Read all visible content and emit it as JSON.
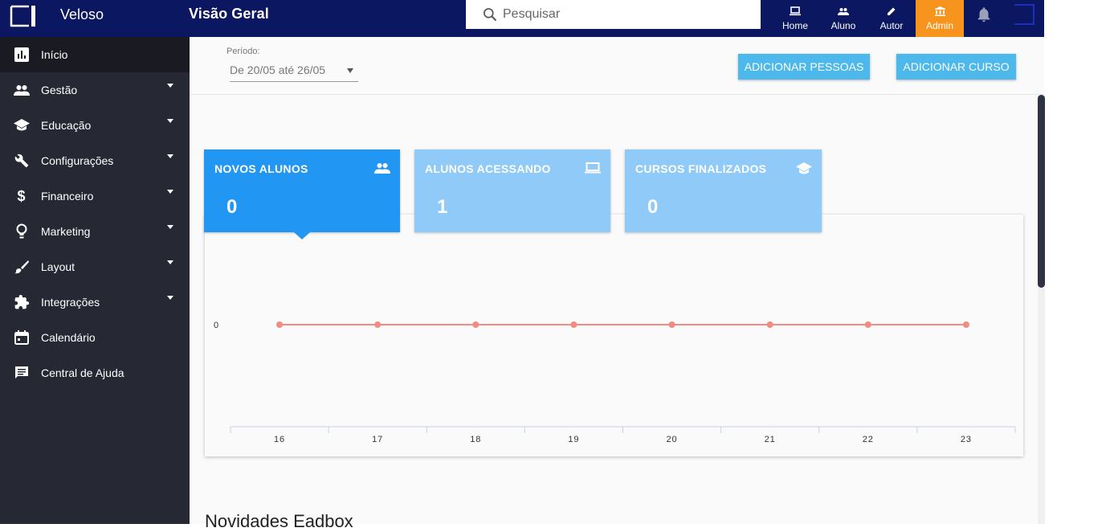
{
  "brand": "Veloso",
  "page_title": "Visão Geral",
  "search": {
    "placeholder": "Pesquisar"
  },
  "nav": {
    "home": "Home",
    "aluno": "Aluno",
    "autor": "Autor",
    "admin": "Admin"
  },
  "colors": {
    "topbar": "#0b1760",
    "sidebar": "#262833",
    "accent": "#f7941d",
    "primary": "#2196f3",
    "primary_light": "#90caf9",
    "button": "#4cb8ec",
    "line": "#f28b82"
  },
  "sidebar": {
    "items": [
      {
        "label": "Início",
        "icon": "bar-chart-icon",
        "expandable": false,
        "active": true
      },
      {
        "label": "Gestão",
        "icon": "people-icon",
        "expandable": true
      },
      {
        "label": "Educação",
        "icon": "graduation-cap-icon",
        "expandable": true
      },
      {
        "label": "Configurações",
        "icon": "wrench-icon",
        "expandable": true
      },
      {
        "label": "Financeiro",
        "icon": "dollar-icon",
        "expandable": true
      },
      {
        "label": "Marketing",
        "icon": "lightbulb-icon",
        "expandable": true
      },
      {
        "label": "Layout",
        "icon": "brush-icon",
        "expandable": true
      },
      {
        "label": "Integrações",
        "icon": "puzzle-icon",
        "expandable": true
      },
      {
        "label": "Calendário",
        "icon": "calendar-icon",
        "expandable": false
      },
      {
        "label": "Central de Ajuda",
        "icon": "chat-icon",
        "expandable": false
      }
    ]
  },
  "filter": {
    "period_label": "Período:",
    "period_value": "De 20/05 até 26/05",
    "add_people": "ADICIONAR PESSOAS",
    "add_course": "ADICIONAR CURSO"
  },
  "cards": [
    {
      "title": "NOVOS ALUNOS",
      "value": "0",
      "icon": "people-icon",
      "selected": true
    },
    {
      "title": "ALUNOS ACESSANDO",
      "value": "1",
      "icon": "laptop-icon",
      "selected": false
    },
    {
      "title": "CURSOS FINALIZADOS",
      "value": "0",
      "icon": "graduation-cap-icon",
      "selected": false
    }
  ],
  "chart_data": {
    "type": "line",
    "x": [
      "16",
      "17",
      "18",
      "19",
      "20",
      "21",
      "22",
      "23"
    ],
    "series": [
      {
        "values": [
          0,
          0,
          0,
          0,
          0,
          0,
          0,
          0
        ]
      }
    ],
    "y_ticks": [
      "0"
    ],
    "title": "",
    "xlabel": "",
    "ylabel": "",
    "grid": false
  },
  "news_title": "Novidades Eadbox"
}
